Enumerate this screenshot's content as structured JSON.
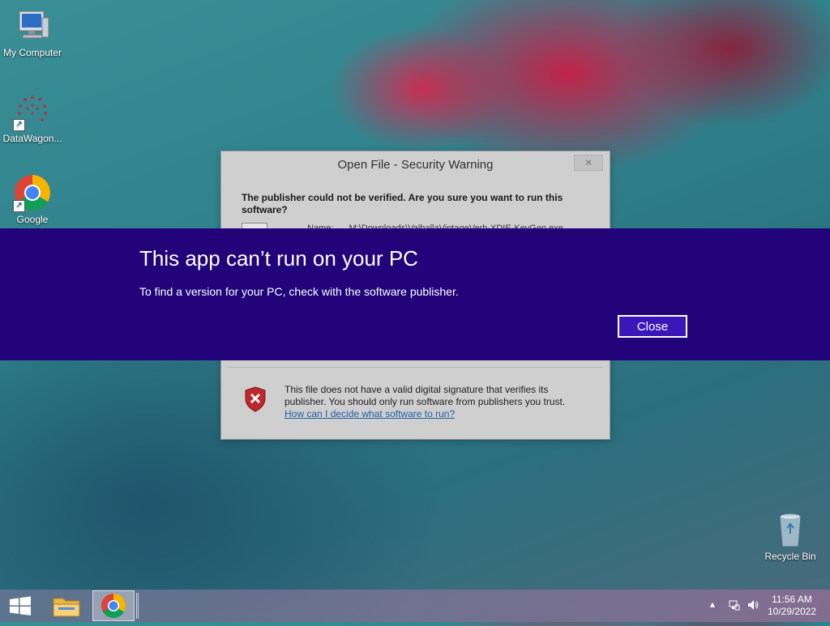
{
  "desktop": {
    "icons": [
      {
        "label": "My Computer"
      },
      {
        "label": "DataWagon..."
      },
      {
        "label": "Google"
      },
      {
        "label": "Recycle Bin"
      }
    ]
  },
  "security_dialog": {
    "title": "Open File - Security Warning",
    "close_glyph": "✕",
    "heading": "The publisher could not be verified.  Are you sure you want to run this software?",
    "name_label": "Name:",
    "name_value": "M:\\Downloads\\ValhallaVintageVerb-XDIE-KeyGen.exe",
    "warning_text": "This file does not have a valid digital signature that verifies its publisher.  You should only run software from publishers you trust.",
    "help_link": "How can I decide what software to run?"
  },
  "banner": {
    "title": "This app can’t run on your PC",
    "message": "To find a version for your PC, check with the software publisher.",
    "close_label": "Close"
  },
  "taskbar": {
    "time": "11:56 AM",
    "date": "10/29/2022",
    "tray_chevron": "▴"
  },
  "colors": {
    "banner_bg": "#22037a",
    "button_bg": "#3b16b8"
  }
}
